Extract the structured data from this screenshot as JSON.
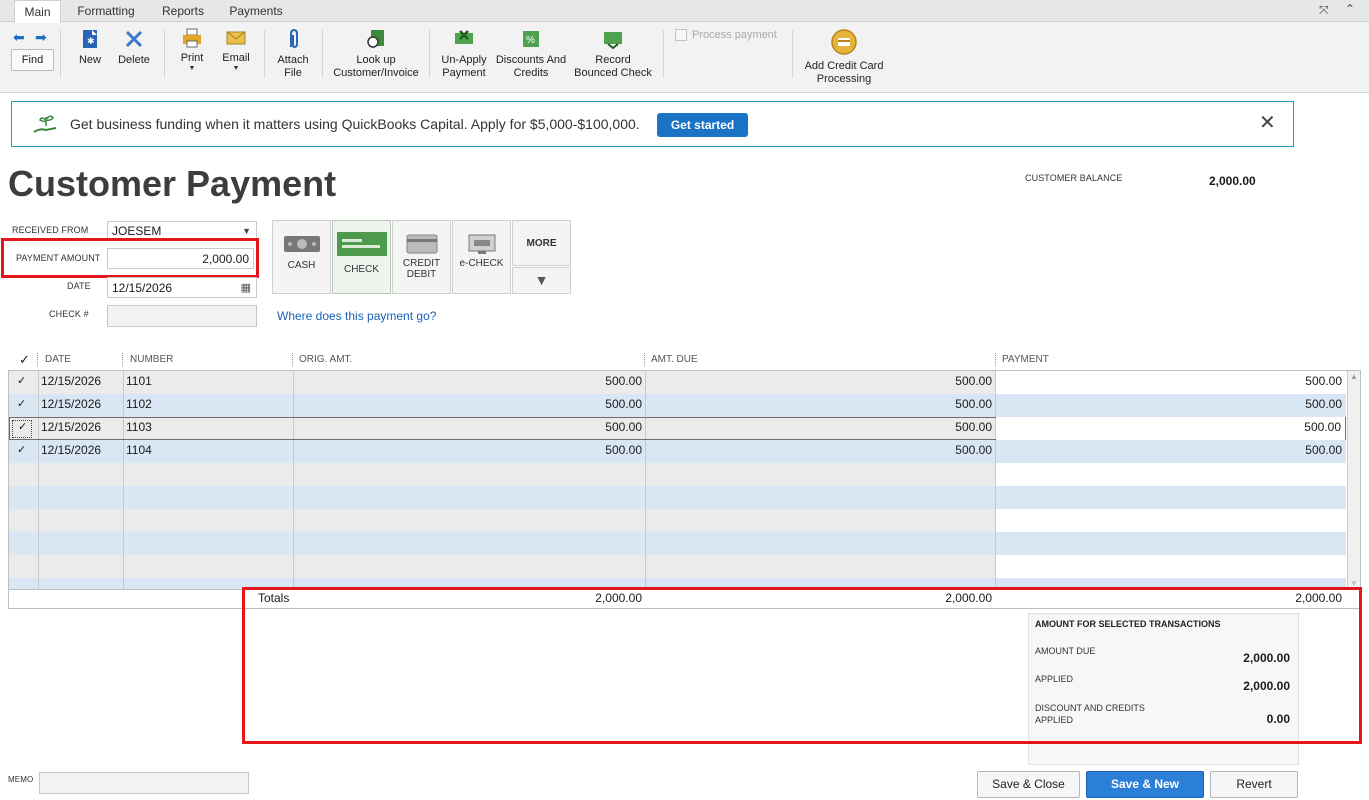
{
  "tabs": [
    "Main",
    "Formatting",
    "Reports",
    "Payments"
  ],
  "toolbar": {
    "find": "Find",
    "new": "New",
    "delete": "Delete",
    "print": "Print",
    "email": "Email",
    "attach": [
      "Attach",
      "File"
    ],
    "lookup": [
      "Look up",
      "Customer/Invoice"
    ],
    "unapply": [
      "Un-Apply",
      "Payment"
    ],
    "discounts": [
      "Discounts And",
      "Credits"
    ],
    "bounced": [
      "Record",
      "Bounced Check"
    ],
    "process_payment": "Process payment",
    "credit_card": [
      "Add Credit Card",
      "Processing"
    ]
  },
  "banner": {
    "text": "Get business funding when it matters using QuickBooks Capital. Apply for $5,000-$100,000.",
    "button": "Get started"
  },
  "page_title": "Customer Payment",
  "customer_balance": {
    "label": "CUSTOMER BALANCE",
    "value": "2,000.00"
  },
  "form": {
    "received_from_label": "RECEIVED FROM",
    "received_from_value": "JOESEM",
    "payment_amount_label": "PAYMENT AMOUNT",
    "payment_amount_value": "2,000.00",
    "date_label": "DATE",
    "date_value": "12/15/2026",
    "check_label": "CHECK #",
    "check_value": "",
    "where_link": "Where does this payment go?"
  },
  "payment_methods": {
    "cash": "CASH",
    "check": "CHECK",
    "credit_debit": [
      "CREDIT",
      "DEBIT"
    ],
    "echeck": "e-CHECK",
    "more": "MORE"
  },
  "table": {
    "headers": {
      "check": "✓",
      "date": "DATE",
      "number": "NUMBER",
      "orig": "ORIG. AMT.",
      "due": "AMT. DUE",
      "payment": "PAYMENT"
    },
    "rows": [
      {
        "check": "✓",
        "date": "12/15/2026",
        "number": "1101",
        "orig": "500.00",
        "due": "500.00",
        "payment": "500.00"
      },
      {
        "check": "✓",
        "date": "12/15/2026",
        "number": "1102",
        "orig": "500.00",
        "due": "500.00",
        "payment": "500.00"
      },
      {
        "check": "✓",
        "date": "12/15/2026",
        "number": "1103",
        "orig": "500.00",
        "due": "500.00",
        "payment": "500.00"
      },
      {
        "check": "✓",
        "date": "12/15/2026",
        "number": "1104",
        "orig": "500.00",
        "due": "500.00",
        "payment": "500.00"
      }
    ],
    "totals": {
      "label": "Totals",
      "orig": "2,000.00",
      "due": "2,000.00",
      "payment": "2,000.00"
    }
  },
  "summary": {
    "title": "AMOUNT FOR SELECTED TRANSACTIONS",
    "amount_due_label": "AMOUNT DUE",
    "amount_due_value": "2,000.00",
    "applied_label": "APPLIED",
    "applied_value": "2,000.00",
    "discount_label": [
      "DISCOUNT AND CREDITS",
      "APPLIED"
    ],
    "discount_value": "0.00"
  },
  "memo_label": "MEMO",
  "buttons": {
    "save_close": "Save & Close",
    "save_new": "Save & New",
    "revert": "Revert"
  },
  "colors": {
    "accent": "#1a73c7",
    "highlight": "#e3161c",
    "banner_border": "#29a0b8",
    "row_alt": "#d9e6f4"
  }
}
